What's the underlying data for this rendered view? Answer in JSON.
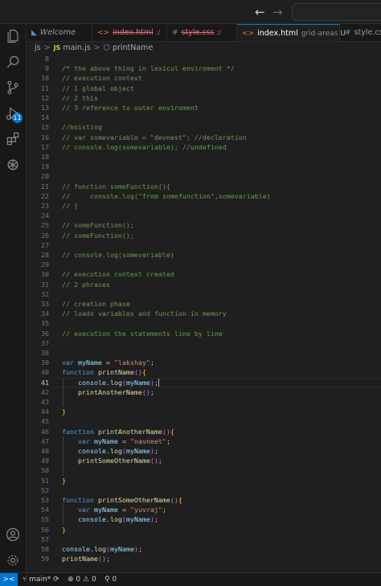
{
  "titlebar": {
    "back_icon": "arrow-left-icon",
    "forward_icon": "arrow-right-icon",
    "back_glyph": "←",
    "forward_glyph": "→"
  },
  "activity": {
    "scm_badge": "11",
    "icons": [
      "explorer-icon",
      "search-icon",
      "source-control-icon",
      "run-debug-icon",
      "extensions-icon",
      "openai-icon",
      "account-icon",
      "settings-gear-icon"
    ]
  },
  "tabs": [
    {
      "icon": "vscode-logo-icon",
      "label": "Welcome"
    },
    {
      "icon": "html-code-icon",
      "icon_glyph": "<>",
      "label": "index.html",
      "suffix": ":/"
    },
    {
      "icon": "css-hash-icon",
      "icon_glyph": "#",
      "label": "style.css",
      "suffix": ":/"
    },
    {
      "icon": "html-code-icon",
      "icon_glyph": "<>",
      "label": "index.html",
      "extra": "grid-areas",
      "status": "U"
    },
    {
      "icon": "css-hash-icon",
      "icon_glyph": "#",
      "label": "style.cs"
    }
  ],
  "breadcrumb": {
    "folder": "js",
    "file_badge": "JS",
    "file": "main.js",
    "symbol": "printName",
    "sep": ">"
  },
  "editor": {
    "current_line": 41,
    "lines": [
      {
        "n": "8",
        "t": ""
      },
      {
        "n": "9",
        "t": "/* the above thing in lexicul enviroment */"
      },
      {
        "n": "10",
        "t": "// execution context"
      },
      {
        "n": "11",
        "t": "// 1 global object"
      },
      {
        "n": "12",
        "t": "// 2 this"
      },
      {
        "n": "13",
        "t": "// 3 reference to outer enviroment"
      },
      {
        "n": "14",
        "t": ""
      },
      {
        "n": "15",
        "t": "//hoisting"
      },
      {
        "n": "16",
        "t": "// var somevariable = \"devnest\"; //decleration"
      },
      {
        "n": "17",
        "t": "// console.log(somevariable); //undefined"
      },
      {
        "n": "18",
        "t": ""
      },
      {
        "n": "19",
        "t": ""
      },
      {
        "n": "20",
        "t": ""
      },
      {
        "n": "21",
        "t": "// function someFunction(){"
      },
      {
        "n": "22",
        "t": "//     console.log(\"from somefunction\",somevariable)"
      },
      {
        "n": "23",
        "t": "// }"
      },
      {
        "n": "24",
        "t": ""
      },
      {
        "n": "25",
        "t": "// someFunction();"
      },
      {
        "n": "26",
        "t": "// someFunction();"
      },
      {
        "n": "27",
        "t": ""
      },
      {
        "n": "28",
        "t": "// console.log(somevariable)"
      },
      {
        "n": "29",
        "t": ""
      },
      {
        "n": "30",
        "t": "// execution context created"
      },
      {
        "n": "31",
        "t": "// 2 phrases"
      },
      {
        "n": "32",
        "t": ""
      },
      {
        "n": "33",
        "t": "// creation phase"
      },
      {
        "n": "34",
        "t": "// loads variables and function in memory"
      },
      {
        "n": "35",
        "t": ""
      },
      {
        "n": "36",
        "t": "// execution the statements line by line"
      },
      {
        "n": "37",
        "t": ""
      },
      {
        "n": "38",
        "t": ""
      },
      {
        "n": "39",
        "t": "var myName = \"lakshay\";"
      },
      {
        "n": "40",
        "t": "function printName(){"
      },
      {
        "n": "41",
        "t": "    console.log(myName);"
      },
      {
        "n": "42",
        "t": "    printAnotherName();"
      },
      {
        "n": "43",
        "t": ""
      },
      {
        "n": "44",
        "t": "}"
      },
      {
        "n": "45",
        "t": ""
      },
      {
        "n": "46",
        "t": "function printAnotherName(){"
      },
      {
        "n": "47",
        "t": "    var myName = \"navneet\";"
      },
      {
        "n": "48",
        "t": "    console.log(myName);"
      },
      {
        "n": "49",
        "t": "    printSomeOtherName();"
      },
      {
        "n": "50",
        "t": ""
      },
      {
        "n": "51",
        "t": "}"
      },
      {
        "n": "52",
        "t": ""
      },
      {
        "n": "53",
        "t": "function printSomeOtherName(){"
      },
      {
        "n": "54",
        "t": "    var myName = \"yuvraj\";"
      },
      {
        "n": "55",
        "t": "    console.log(myName);"
      },
      {
        "n": "56",
        "t": "}"
      },
      {
        "n": "57",
        "t": ""
      },
      {
        "n": "58",
        "t": "console.log(myName);"
      },
      {
        "n": "59",
        "t": "printName();"
      }
    ]
  },
  "statusbar": {
    "remote_glyph": "><",
    "branch": "main*",
    "sync_glyph": "⟳",
    "errors": "0",
    "warnings": "0",
    "ports": "0"
  },
  "colors": {
    "accent": "#0078d4",
    "comment": "#6a9955",
    "keyword": "#569cd6",
    "function": "#dcdcaa",
    "variable": "#9cdcfe",
    "string": "#ce9178"
  }
}
